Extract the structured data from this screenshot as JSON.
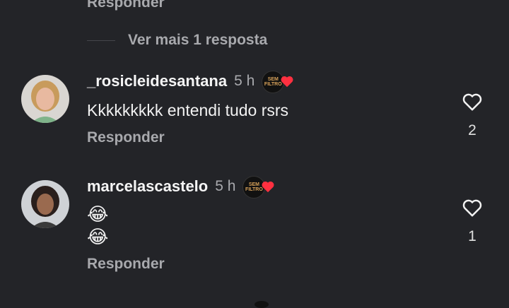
{
  "top": {
    "reply_label": "Responder",
    "more_replies_label": "Ver mais 1 resposta"
  },
  "comments": [
    {
      "username": "_rosicleidesantana",
      "time": "5 h",
      "text": "Kkkkkkkkk entendi tudo rsrs",
      "reply_label": "Responder",
      "likes": "2"
    },
    {
      "username": "marcelascastelo",
      "time": "5 h",
      "emoji_lines": [
        "😂",
        "😂"
      ],
      "reply_label": "Responder",
      "likes": "1"
    }
  ],
  "badge": {
    "text": "SEM\nFILTRO",
    "heart_color": "#ff3040"
  },
  "colors": {
    "background": "#232428",
    "muted": "#a8a9ad",
    "text": "#f2f2f2"
  }
}
